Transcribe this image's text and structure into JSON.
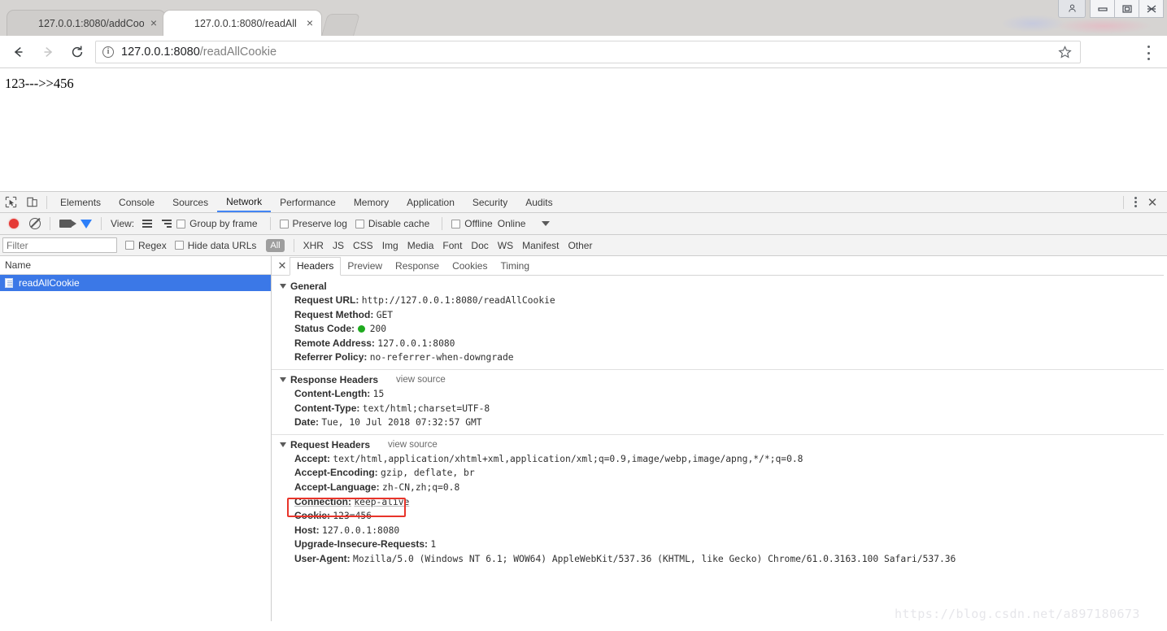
{
  "browser": {
    "tabs": [
      {
        "title": "127.0.0.1:8080/addCoo",
        "favicon": "spring-leaf-icon",
        "active": false,
        "close_label": "×"
      },
      {
        "title": "127.0.0.1:8080/readAll",
        "favicon": "spring-leaf-icon",
        "active": true,
        "close_label": "×"
      }
    ],
    "window_controls": {
      "profile": "⛉",
      "minimize": "─",
      "maximize": "❐",
      "close": "✖"
    },
    "toolbar": {
      "back": "←",
      "forward": "→",
      "reload": "⟳",
      "site_info_icon": "i",
      "url_host": "127.0.0.1:8080",
      "url_path": "/readAllCookie",
      "url_full": "127.0.0.1:8080/readAllCookie",
      "bookmark_icon": "☆"
    }
  },
  "page": {
    "body_text": "123--->>456"
  },
  "devtools": {
    "tabs": [
      {
        "label": "Elements",
        "selected": false
      },
      {
        "label": "Console",
        "selected": false
      },
      {
        "label": "Sources",
        "selected": false
      },
      {
        "label": "Network",
        "selected": true
      },
      {
        "label": "Performance",
        "selected": false
      },
      {
        "label": "Memory",
        "selected": false
      },
      {
        "label": "Application",
        "selected": false
      },
      {
        "label": "Security",
        "selected": false
      },
      {
        "label": "Audits",
        "selected": false
      }
    ],
    "close_label": "✕",
    "network_toolbar": {
      "view_label": "View:",
      "group_by_frame": "Group by frame",
      "preserve_log": "Preserve log",
      "disable_cache": "Disable cache",
      "offline": "Offline",
      "throttle": "Online"
    },
    "filter_bar": {
      "filter_placeholder": "Filter",
      "filter_value": "",
      "regex": "Regex",
      "hide_data_urls": "Hide data URLs",
      "types": [
        "All",
        "XHR",
        "JS",
        "CSS",
        "Img",
        "Media",
        "Font",
        "Doc",
        "WS",
        "Manifest",
        "Other"
      ]
    },
    "requests": {
      "column_header": "Name",
      "rows": [
        {
          "name": "readAllCookie",
          "selected": true
        }
      ]
    },
    "detail_tabs": [
      {
        "label": "Headers",
        "selected": true
      },
      {
        "label": "Preview",
        "selected": false
      },
      {
        "label": "Response",
        "selected": false
      },
      {
        "label": "Cookies",
        "selected": false
      },
      {
        "label": "Timing",
        "selected": false
      }
    ],
    "sections": [
      {
        "title": "General",
        "view_source": "",
        "rows": [
          {
            "key": "Request URL:",
            "value": "http://127.0.0.1:8080/readAllCookie"
          },
          {
            "key": "Request Method:",
            "value": "GET"
          },
          {
            "key": "Status Code:",
            "value": "200",
            "status_dot": true
          },
          {
            "key": "Remote Address:",
            "value": "127.0.0.1:8080"
          },
          {
            "key": "Referrer Policy:",
            "value": "no-referrer-when-downgrade"
          }
        ]
      },
      {
        "title": "Response Headers",
        "view_source": "view source",
        "rows": [
          {
            "key": "Content-Length:",
            "value": "15"
          },
          {
            "key": "Content-Type:",
            "value": "text/html;charset=UTF-8"
          },
          {
            "key": "Date:",
            "value": "Tue, 10 Jul 2018 07:32:57 GMT"
          }
        ]
      },
      {
        "title": "Request Headers",
        "view_source": "view source",
        "rows": [
          {
            "key": "Accept:",
            "value": "text/html,application/xhtml+xml,application/xml;q=0.9,image/webp,image/apng,*/*;q=0.8"
          },
          {
            "key": "Accept-Encoding:",
            "value": "gzip, deflate, br"
          },
          {
            "key": "Accept-Language:",
            "value": "zh-CN,zh;q=0.8"
          },
          {
            "key": "Connection:",
            "value": "keep-alive",
            "underline": true
          },
          {
            "key": "Cookie:",
            "value": "123=456",
            "highlighted": true
          },
          {
            "key": "Host:",
            "value": "127.0.0.1:8080"
          },
          {
            "key": "Upgrade-Insecure-Requests:",
            "value": "1"
          },
          {
            "key": "User-Agent:",
            "value": "Mozilla/5.0 (Windows NT 6.1; WOW64) AppleWebKit/537.36 (KHTML, like Gecko) Chrome/61.0.3163.100 Safari/537.36"
          }
        ]
      }
    ]
  },
  "watermark": "https://blog.csdn.net/a897180673",
  "colors": {
    "accent_blue": "#4285f4",
    "selection_blue": "#3b78e7",
    "record_red": "#e53935",
    "highlight_red": "#e8342a",
    "status_green": "#1faa1f"
  }
}
